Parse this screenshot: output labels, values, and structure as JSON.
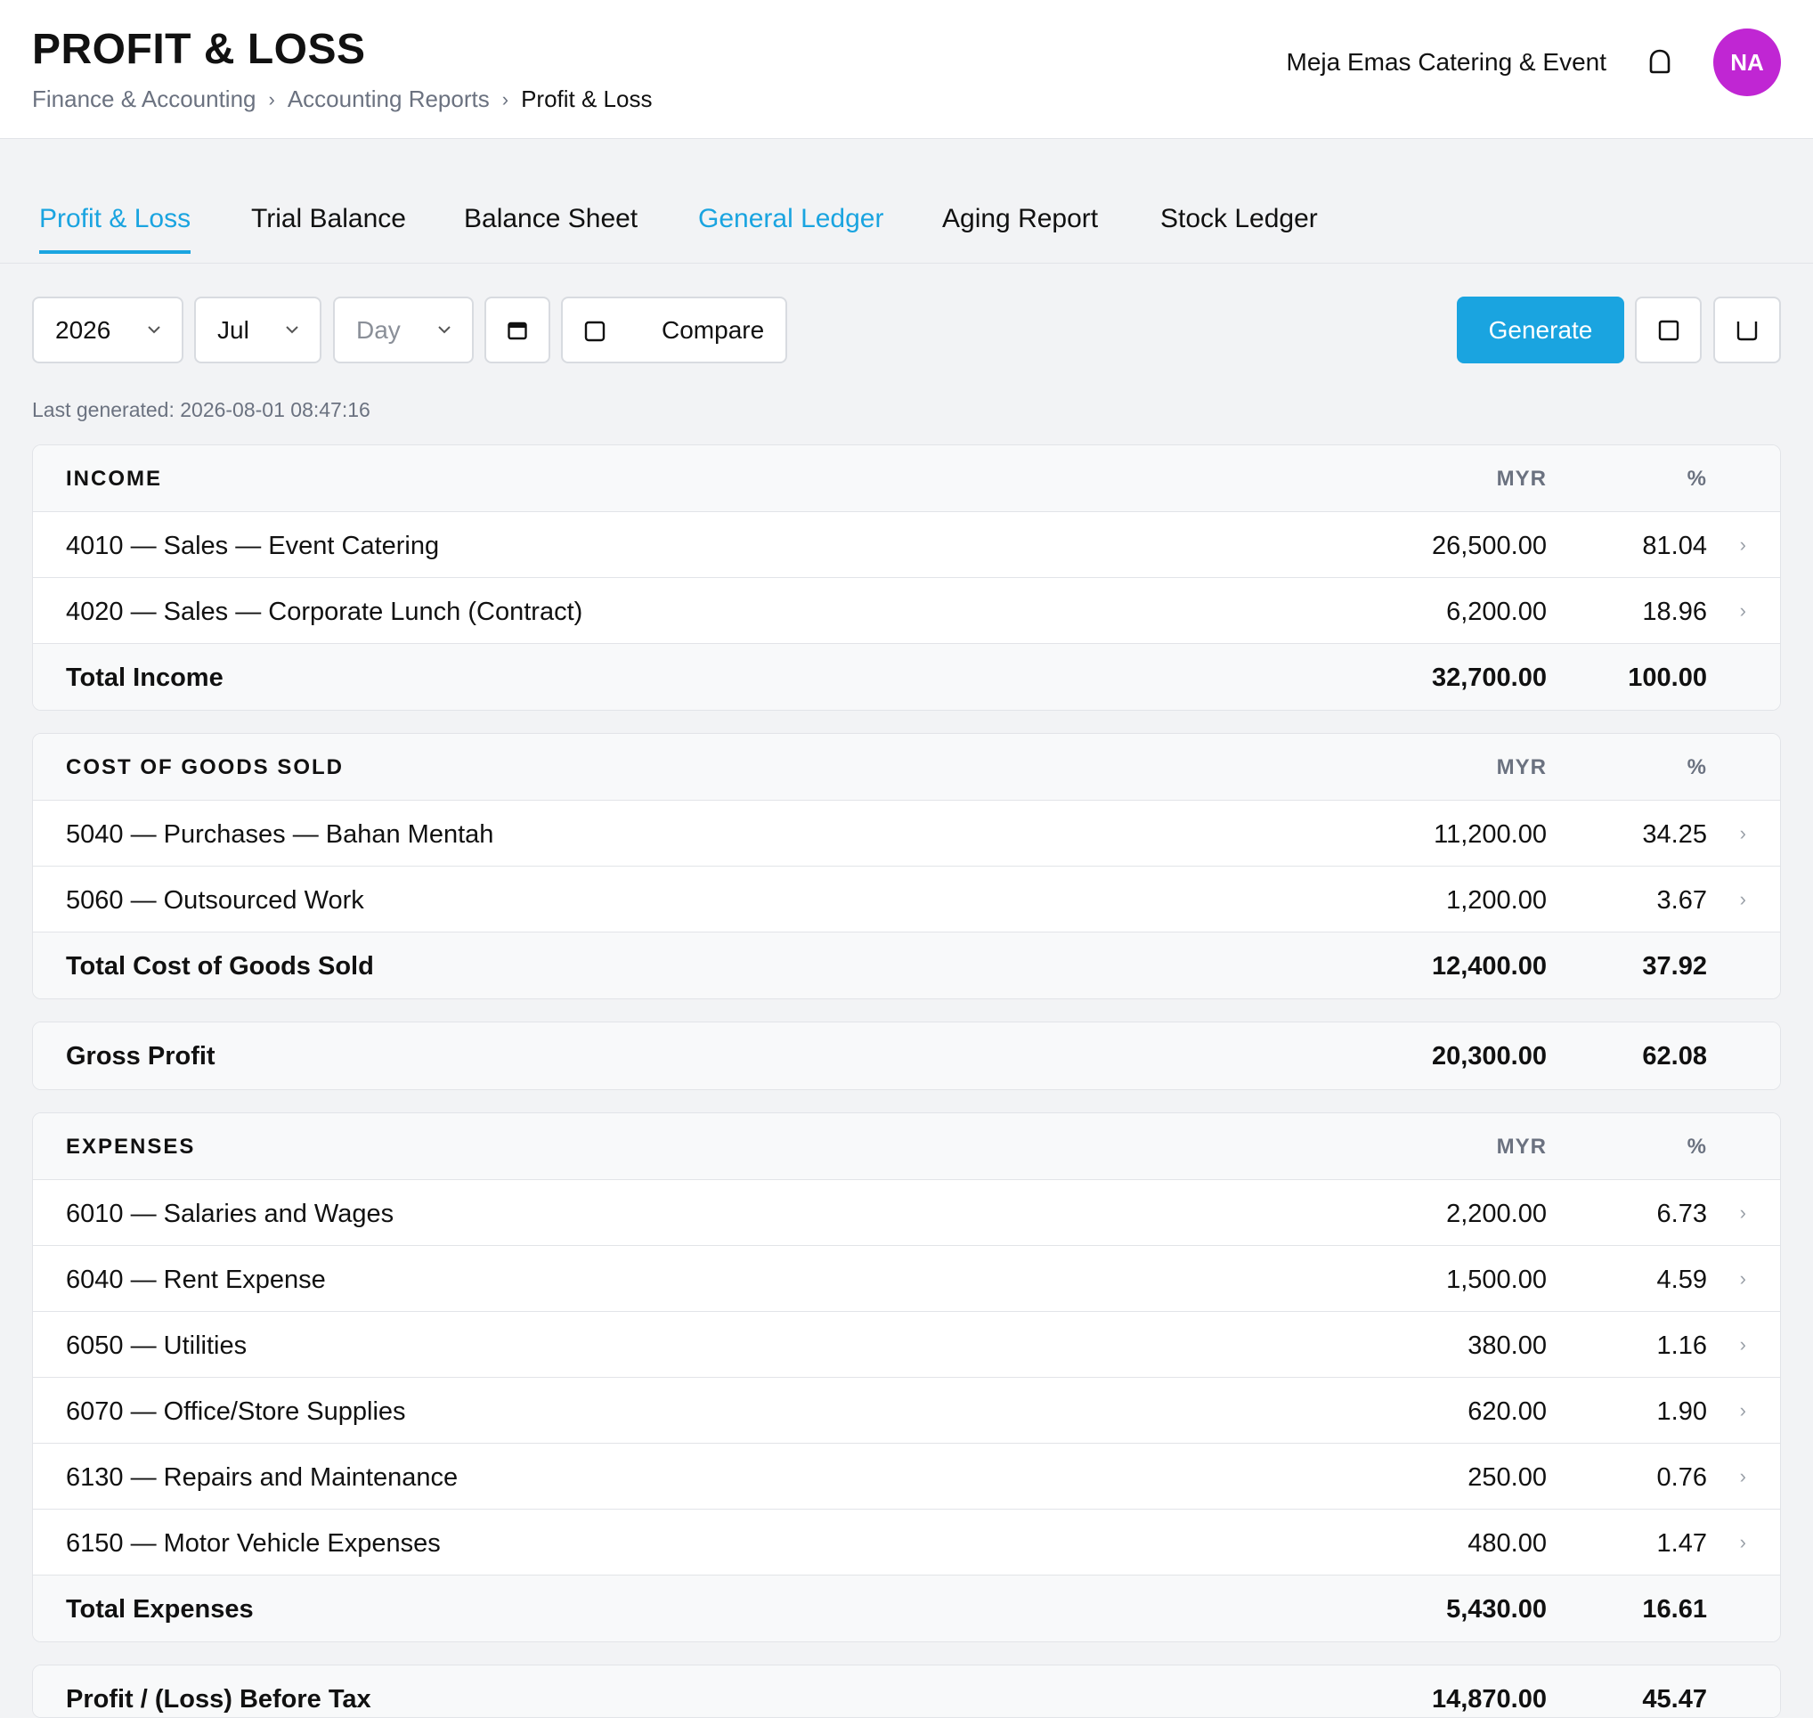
{
  "header": {
    "title": "PROFIT & LOSS",
    "breadcrumb": [
      "Finance & Accounting",
      "Accounting Reports",
      "Profit & Loss"
    ],
    "company": "Meja Emas Catering & Event",
    "avatar_initials": "NA",
    "avatar_color": "#c026d3"
  },
  "tabs": [
    "Profit & Loss",
    "Trial Balance",
    "Balance Sheet",
    "General Ledger",
    "Aging Report",
    "Stock Ledger"
  ],
  "filters": {
    "year": "2026",
    "month": "Jul",
    "day_placeholder": "Day",
    "compare_label": "Compare",
    "generate_label": "Generate"
  },
  "last_generated": "Last generated: 2026-08-01 08:47:16",
  "columns": {
    "amount": "MYR",
    "percent": "%"
  },
  "income": {
    "title": "INCOME",
    "rows": [
      {
        "name": "4010 — Sales — Event Catering",
        "amount": "26,500.00",
        "pct": "81.04"
      },
      {
        "name": "4020 — Sales — Corporate Lunch (Contract)",
        "amount": "6,200.00",
        "pct": "18.96"
      }
    ],
    "total": {
      "name": "Total Income",
      "amount": "32,700.00",
      "pct": "100.00"
    }
  },
  "cogs": {
    "title": "COST OF GOODS SOLD",
    "rows": [
      {
        "name": "5040 — Purchases — Bahan Mentah",
        "amount": "11,200.00",
        "pct": "34.25"
      },
      {
        "name": "5060 — Outsourced Work",
        "amount": "1,200.00",
        "pct": "3.67"
      }
    ],
    "total": {
      "name": "Total Cost of Goods Sold",
      "amount": "12,400.00",
      "pct": "37.92"
    }
  },
  "gross_profit": {
    "name": "Gross Profit",
    "amount": "20,300.00",
    "pct": "62.08"
  },
  "expenses": {
    "title": "EXPENSES",
    "rows": [
      {
        "name": "6010 — Salaries and Wages",
        "amount": "2,200.00",
        "pct": "6.73"
      },
      {
        "name": "6040 — Rent Expense",
        "amount": "1,500.00",
        "pct": "4.59"
      },
      {
        "name": "6050 — Utilities",
        "amount": "380.00",
        "pct": "1.16"
      },
      {
        "name": "6070 — Office/Store Supplies",
        "amount": "620.00",
        "pct": "1.90"
      },
      {
        "name": "6130 — Repairs and Maintenance",
        "amount": "250.00",
        "pct": "0.76"
      },
      {
        "name": "6150 — Motor Vehicle Expenses",
        "amount": "480.00",
        "pct": "1.47"
      }
    ],
    "total": {
      "name": "Total Expenses",
      "amount": "5,430.00",
      "pct": "16.61"
    }
  },
  "profit_before_tax": {
    "name": "Profit / (Loss) Before Tax",
    "amount": "14,870.00",
    "pct": "45.47"
  },
  "colors": {
    "accent": "#1aa4e0"
  }
}
